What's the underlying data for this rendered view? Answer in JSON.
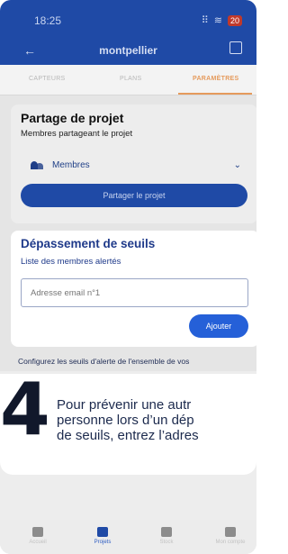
{
  "status_bar": {
    "time": "18:25",
    "battery": "20"
  },
  "header": {
    "title": "montpellier"
  },
  "tabs": [
    {
      "label": "CAPTEURS",
      "active": false
    },
    {
      "label": "PLANS",
      "active": false
    },
    {
      "label": "PARAMÈTRES",
      "active": true
    }
  ],
  "share": {
    "title": "Partage de projet",
    "subtitle": "Membres partageant le projet",
    "members_label": "Membres",
    "button": "Partager le projet"
  },
  "alerts": {
    "title": "Dépassement de seuils",
    "subtitle": "Liste des membres alertés",
    "email_placeholder": "Adresse email n°1",
    "add_button": "Ajouter"
  },
  "thresholds_desc": "Configurez les seuils d'alerte de l'ensemble de vos",
  "callout": {
    "step": "4",
    "line1": "Pour prévenir une autr",
    "line2": "personne lors d’un dép",
    "line3": "de seuils, entrez l’adres"
  },
  "bottom_nav": [
    {
      "label": "Accueil",
      "active": false
    },
    {
      "label": "Projets",
      "active": true
    },
    {
      "label": "Stock",
      "active": false
    },
    {
      "label": "Mon compte",
      "active": false
    }
  ],
  "colors": {
    "primary": "#1f4aa6",
    "accent": "#e59a5c",
    "button_blue": "#2560d8",
    "battery_red": "#c0392b"
  }
}
